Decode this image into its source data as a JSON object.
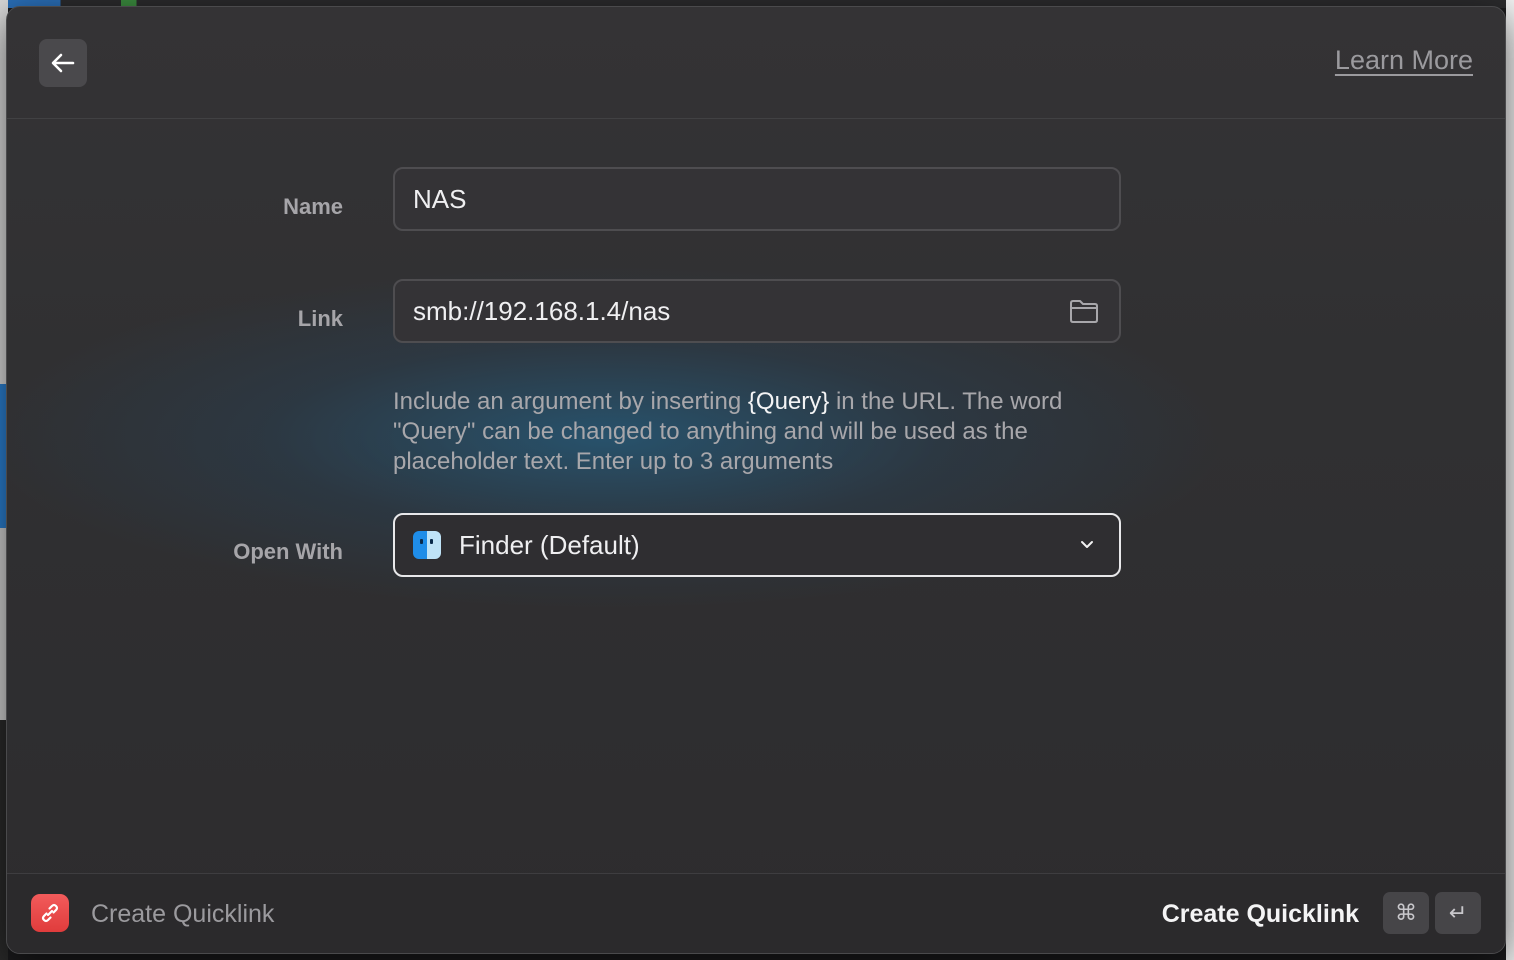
{
  "header": {
    "back_icon": "arrow-left-icon",
    "learn_more": "Learn More"
  },
  "form": {
    "name_label": "Name",
    "name_value": "NAS",
    "link_label": "Link",
    "link_value": "smb://192.168.1.4/nas",
    "link_icon": "folder-icon",
    "help_prefix": "Include an argument by inserting ",
    "help_query": "{Query}",
    "help_suffix": " in the URL. The word \"Query\" can be changed to anything and will be used as the placeholder text. Enter up to 3 arguments",
    "open_with_label": "Open With",
    "open_with_value": "Finder (Default)",
    "open_with_icon": "finder-icon"
  },
  "footer": {
    "app_icon": "link-icon",
    "title": "Create Quicklink",
    "action_label": "Create Quicklink",
    "key_cmd": "⌘",
    "key_return": "↵"
  },
  "colors": {
    "background": "#303032",
    "accent_icon": "#e84545",
    "text_primary": "#efeff1",
    "text_secondary": "#a6a5a9"
  }
}
